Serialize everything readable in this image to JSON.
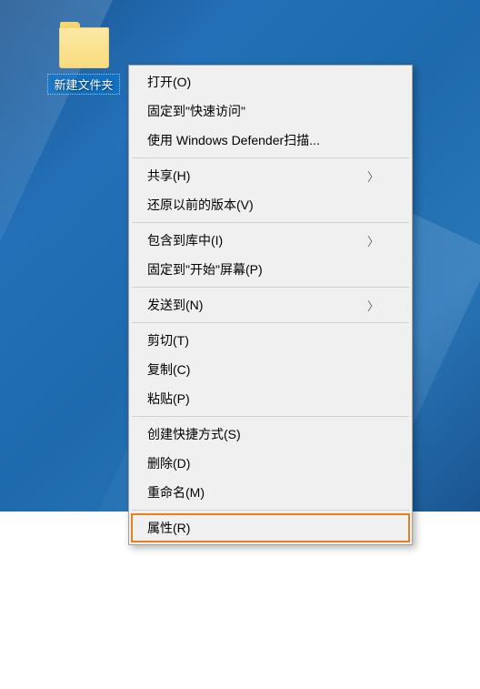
{
  "desktop": {
    "icon_label": "新建文件夹"
  },
  "context_menu": {
    "items": [
      {
        "label": "打开(O)",
        "has_submenu": false
      },
      {
        "label": "固定到\"快速访问\"",
        "has_submenu": false
      },
      {
        "label": "使用 Windows Defender扫描...",
        "has_submenu": false
      }
    ],
    "group2": [
      {
        "label": "共享(H)",
        "has_submenu": true
      },
      {
        "label": "还原以前的版本(V)",
        "has_submenu": false
      }
    ],
    "group3": [
      {
        "label": "包含到库中(I)",
        "has_submenu": true
      },
      {
        "label": "固定到\"开始\"屏幕(P)",
        "has_submenu": false
      }
    ],
    "group4": [
      {
        "label": "发送到(N)",
        "has_submenu": true
      }
    ],
    "group5": [
      {
        "label": "剪切(T)",
        "has_submenu": false
      },
      {
        "label": "复制(C)",
        "has_submenu": false
      },
      {
        "label": "粘贴(P)",
        "has_submenu": false
      }
    ],
    "group6": [
      {
        "label": "创建快捷方式(S)",
        "has_submenu": false
      },
      {
        "label": "删除(D)",
        "has_submenu": false
      },
      {
        "label": "重命名(M)",
        "has_submenu": false
      }
    ],
    "group7": [
      {
        "label": "属性(R)",
        "has_submenu": false,
        "highlighted": true
      }
    ],
    "chevron": "〉"
  }
}
